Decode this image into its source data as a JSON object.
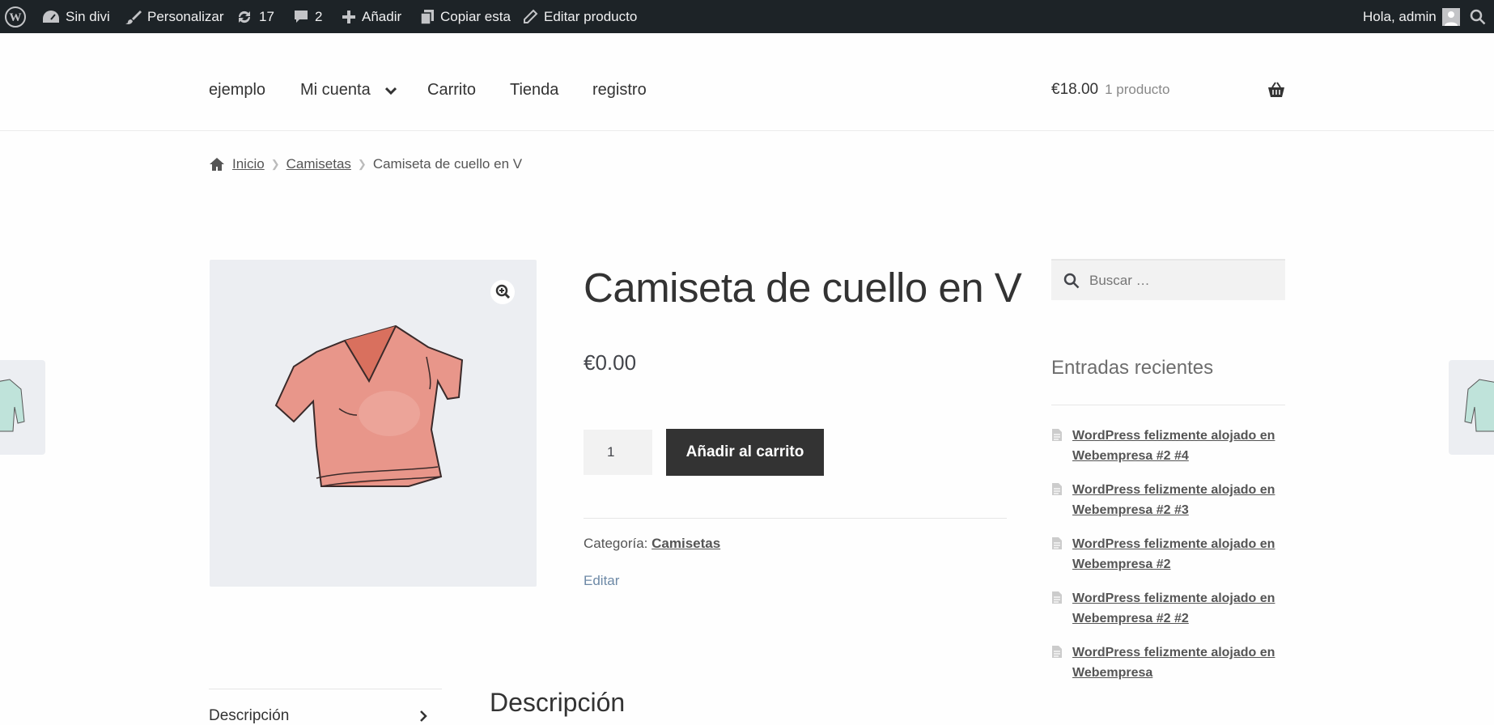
{
  "admin_bar": {
    "site_name": "Sin divi",
    "customize": "Personalizar",
    "updates_count": "17",
    "comments_count": "2",
    "add_new": "Añadir",
    "copy": "Copiar esta",
    "edit_product": "Editar producto",
    "greeting": "Hola, admin",
    "icons": [
      "wordpress-logo-icon",
      "dashboard-icon",
      "brush-icon",
      "updates-icon",
      "comment-icon",
      "plus-icon",
      "copy-icon",
      "pencil-icon",
      "avatar-icon",
      "search-icon"
    ]
  },
  "nav": {
    "items": [
      "ejemplo",
      "Mi cuenta",
      "Carrito",
      "Tienda",
      "registro"
    ]
  },
  "cart": {
    "amount": "€18.00",
    "count": "1 producto",
    "icon": "basket-icon"
  },
  "breadcrumb": {
    "home": "Inicio",
    "category": "Camisetas",
    "current": "Camiseta de cuello en V"
  },
  "product": {
    "title": "Camiseta de cuello en V",
    "price": "€0.00",
    "quantity": "1",
    "add_to_cart": "Añadir al carrito",
    "category_label": "Categoría:",
    "category": "Camisetas",
    "edit": "Editar"
  },
  "sidebar": {
    "search_placeholder": "Buscar …",
    "recent_title": "Entradas recientes",
    "posts": [
      "WordPress felizmente alojado en Webempresa #2 #4",
      "WordPress felizmente alojado en Webempresa #2 #3",
      "WordPress felizmente alojado en Webempresa #2",
      "WordPress felizmente alojado en Webempresa #2 #2",
      "WordPress felizmente alojado en Webempresa"
    ]
  },
  "tabs": {
    "description_tab": "Descripción",
    "description_heading": "Descripción"
  },
  "colors": {
    "admin_bar": "#1d2327",
    "button": "#333333",
    "link_edit": "#6d89a6",
    "shirt": "#e8968a"
  }
}
